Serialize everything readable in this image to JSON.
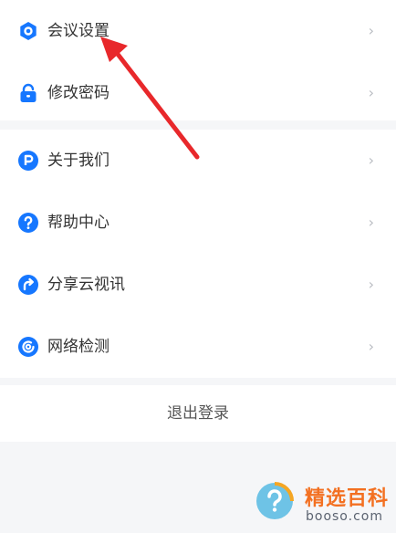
{
  "colors": {
    "accent": "#1677ff",
    "arrow": "#e8282b",
    "text": "#333333",
    "chevron": "#b9bcc2",
    "background": "#f5f6f8",
    "watermark": "#f37021"
  },
  "menu_group_1": [
    {
      "label": "会议设置",
      "icon": "hexagon-settings-icon"
    },
    {
      "label": "修改密码",
      "icon": "lock-icon"
    }
  ],
  "menu_group_2": [
    {
      "label": "关于我们",
      "icon": "p-circle-icon"
    },
    {
      "label": "帮助中心",
      "icon": "question-circle-icon"
    },
    {
      "label": "分享云视讯",
      "icon": "share-circle-icon"
    },
    {
      "label": "网络检测",
      "icon": "network-circle-icon"
    }
  ],
  "chevron": "›",
  "logout": {
    "label": "退出登录"
  },
  "watermark": {
    "text": "精选百科",
    "url": "booso.com"
  }
}
